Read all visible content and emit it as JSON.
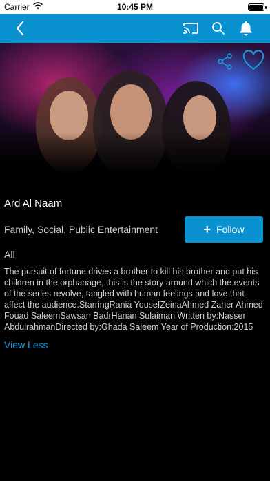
{
  "status_bar": {
    "carrier": "Carrier",
    "time": "10:45 PM"
  },
  "nav": {
    "back_icon": "chevron-left-icon",
    "cast_icon": "cast-icon",
    "search_icon": "search-icon",
    "bell_icon": "bell-icon",
    "bar_color": "#0a92d0"
  },
  "hero": {
    "share_icon": "share-icon",
    "favorite_icon": "heart-icon"
  },
  "show": {
    "title": "Ard Al Naam",
    "genres": "Family, Social, Public Entertainment",
    "season": "All",
    "description": "The pursuit of fortune drives a brother to kill his brother and put his children in the orphanage, this is the story around which the events of the series revolve, tangled with human feelings and love that affect the audience.StarringRania YousefZeinaAhmed Zaher Ahmed Fouad SaleemSawsan BadrHanan Sulaiman Written by:Nasser AbdulrahmanDirected by:Ghada Saleem Year of Production:2015"
  },
  "follow": {
    "label": "Follow",
    "icon": "plus-icon"
  },
  "view_less": "View Less"
}
